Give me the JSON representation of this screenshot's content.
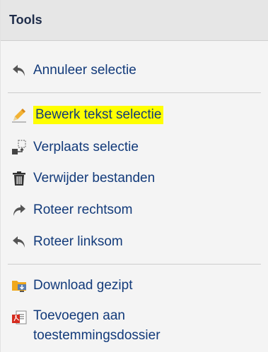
{
  "panel": {
    "title": "Tools"
  },
  "group1": {
    "cancel_selection": {
      "label": "Annuleer selectie",
      "icon": "undo-arrow-icon"
    }
  },
  "group2": {
    "edit_text": {
      "label": "Bewerk tekst selectie",
      "icon": "pencil-icon",
      "highlight_color": "#ffff00"
    },
    "move_selection": {
      "label": "Verplaats selectie",
      "icon": "move-selection-icon"
    },
    "delete_files": {
      "label": "Verwijder bestanden",
      "icon": "trash-icon"
    },
    "rotate_right": {
      "label": "Roteer rechtsom",
      "icon": "rotate-right-icon"
    },
    "rotate_left": {
      "label": "Roteer linksom",
      "icon": "rotate-left-icon"
    }
  },
  "group3": {
    "download_zip": {
      "label": "Download gezipt",
      "icon": "folder-download-icon"
    },
    "add_to_dossier": {
      "label_line1": "Toevoegen aan",
      "label_line2": "toestemmingsdossier",
      "icon": "pdf-document-icon"
    }
  },
  "colors": {
    "link_text": "#123a7a",
    "title_text": "#1f2d4a",
    "header_bg": "#e6e6e6",
    "panel_bg": "#f4f4f4"
  }
}
